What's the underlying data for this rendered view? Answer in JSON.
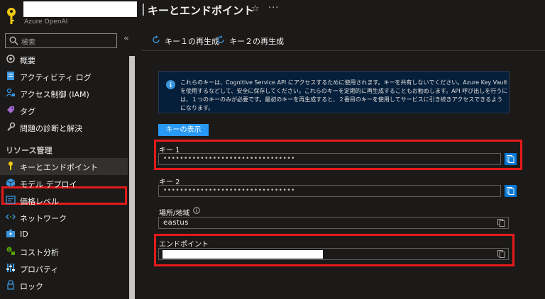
{
  "header": {
    "title": "キーとエンドポイント",
    "subtitle": "Azure OpenAI",
    "separator": "|",
    "star_icon": "star-icon",
    "more_icon": "ellipsis-icon"
  },
  "sidebar": {
    "search_placeholder": "検索",
    "collapse_glyph": "«",
    "section_resource_mgmt": "リソース管理",
    "items": [
      {
        "label": "概要",
        "icon": "overview-icon"
      },
      {
        "label": "アクティビティ ログ",
        "icon": "activity-log-icon"
      },
      {
        "label": "アクセス制御 (IAM)",
        "icon": "iam-icon"
      },
      {
        "label": "タグ",
        "icon": "tag-icon"
      },
      {
        "label": "問題の診断と解決",
        "icon": "wrench-icon"
      },
      {
        "label": "キーとエンドポイント",
        "icon": "key-icon",
        "active": true
      },
      {
        "label": "モデル デプロイ",
        "icon": "cube-icon"
      },
      {
        "label": "価格レベル",
        "icon": "pricing-icon"
      },
      {
        "label": "ネットワーク",
        "icon": "network-icon"
      },
      {
        "label": "ID",
        "icon": "identity-icon"
      },
      {
        "label": "コスト分析",
        "icon": "cost-icon"
      },
      {
        "label": "プロパティ",
        "icon": "properties-icon"
      },
      {
        "label": "ロック",
        "icon": "lock-icon"
      }
    ]
  },
  "toolbar": {
    "regen_key1": "キー１の再生成",
    "regen_key2": "キー２の再生成"
  },
  "info": {
    "text": "これらのキーは、Cognitive Service API にアクセスするために使用されます。キーを共有しないでください。Azure Key Vault を使用するなどして、安全に保存してください。これらのキーを定期的に再生成することもお勧めします。API 呼び出しを行うには、１つのキーのみが必要です。最初のキーを再生成すると、２番目のキーを使用してサービスに引き続きアクセスできるようになります。"
  },
  "show_keys_button": "キーの表示",
  "fields": {
    "key1_label": "キー 1",
    "key1_value": "••••••••••••••••••••••••••••••••",
    "key2_label": "キー 2",
    "key2_value": "••••••••••••••••••••••••••••••••",
    "location_label": "場所/地域",
    "location_value": "eastus",
    "endpoint_label": "エンドポイント"
  },
  "colors": {
    "accent": "#0078d4",
    "highlight_border": "#e51a1a",
    "banner_bg": "#051e3a"
  }
}
